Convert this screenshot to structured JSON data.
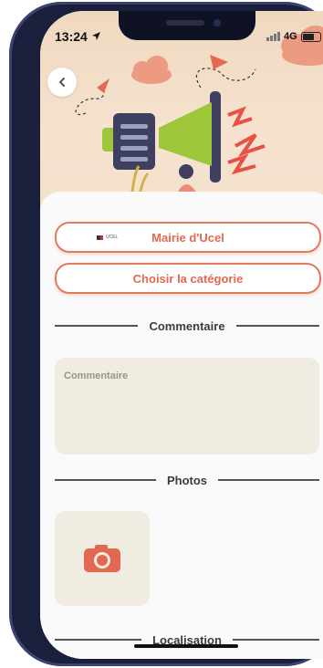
{
  "status_bar": {
    "time": "13:24",
    "network": "4G"
  },
  "institution": {
    "label": "Mairie d'Ucel",
    "logo_text": "UCEL"
  },
  "category": {
    "label": "Choisir la catégorie"
  },
  "comment": {
    "section_title": "Commentaire",
    "placeholder": "Commentaire"
  },
  "photos": {
    "section_title": "Photos"
  },
  "location": {
    "section_title": "Localisation"
  },
  "colors": {
    "accent": "#e2694f",
    "field_bg": "#f1ece2",
    "hero_bg": "#efd8bf"
  },
  "icons": [
    "back-arrow-icon",
    "camera-icon",
    "megaphone-illustration",
    "location-arrow-icon"
  ]
}
